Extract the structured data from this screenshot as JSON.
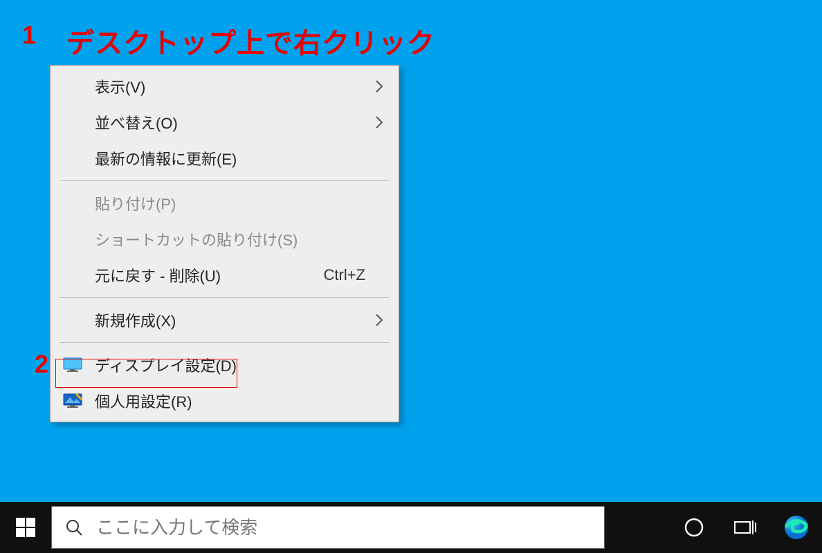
{
  "annotations": {
    "num1": "1",
    "text1": "デスクトップ上で右クリック",
    "num2": "2"
  },
  "context_menu": {
    "items": [
      {
        "label": "表示(V)",
        "has_submenu": true
      },
      {
        "label": "並べ替え(O)",
        "has_submenu": true
      },
      {
        "label": "最新の情報に更新(E)"
      },
      {
        "sep": true
      },
      {
        "label": "貼り付け(P)",
        "disabled": true
      },
      {
        "label": "ショートカットの貼り付け(S)",
        "disabled": true
      },
      {
        "label": "元に戻す - 削除(U)",
        "shortcut": "Ctrl+Z"
      },
      {
        "sep": true
      },
      {
        "label": "新規作成(X)",
        "has_submenu": true
      },
      {
        "sep": true
      },
      {
        "label": "ディスプレイ設定(D)",
        "icon": "display"
      },
      {
        "label": "個人用設定(R)",
        "icon": "personalize"
      }
    ]
  },
  "taskbar": {
    "search_placeholder": "ここに入力して検索"
  }
}
